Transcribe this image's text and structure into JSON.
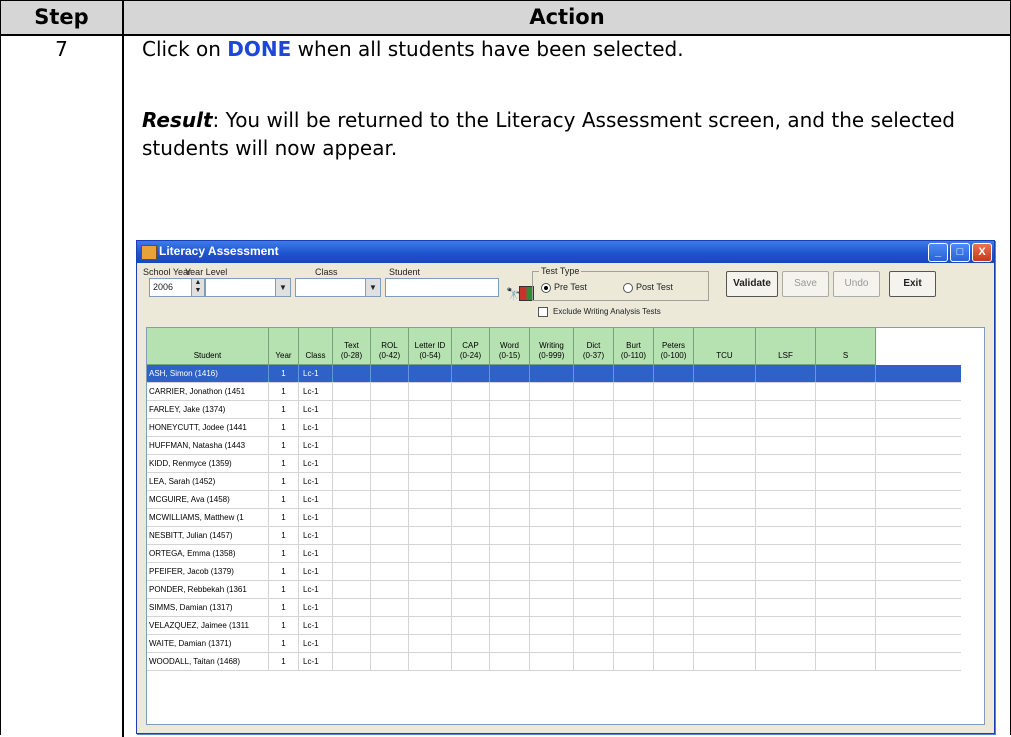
{
  "header": {
    "step": "Step",
    "action": "Action"
  },
  "step_number": "7",
  "instruction": {
    "prefix": "Click on ",
    "keyword": "DONE",
    "suffix": " when all students have been selected."
  },
  "result": {
    "label": "Result",
    "text": ": You will be returned to the Literacy Assessment screen, and the selected students will now appear."
  },
  "window": {
    "title": "Literacy Assessment",
    "controls": {
      "minimize": "_",
      "maximize": "□",
      "close": "X"
    },
    "toolbar": {
      "school_year_label": "School Year",
      "school_year_value": "2006",
      "year_level_label": "Year Level",
      "class_label": "Class",
      "student_label": "Student",
      "test_type_label": "Test Type",
      "pre_test": "Pre Test",
      "post_test": "Post Test",
      "exclude_label": "Exclude Writing Analysis Tests",
      "validate": "Validate",
      "save": "Save",
      "undo": "Undo",
      "exit": "Exit"
    },
    "grid": {
      "columns": [
        {
          "l1": "",
          "l2": "Student"
        },
        {
          "l1": "",
          "l2": "Year"
        },
        {
          "l1": "",
          "l2": "Class"
        },
        {
          "l1": "Text",
          "l2": "(0-28)"
        },
        {
          "l1": "ROL",
          "l2": "(0-42)"
        },
        {
          "l1": "Letter ID",
          "l2": "(0-54)"
        },
        {
          "l1": "CAP",
          "l2": "(0-24)"
        },
        {
          "l1": "Word",
          "l2": "(0-15)"
        },
        {
          "l1": "Writing",
          "l2": "(0-999)"
        },
        {
          "l1": "Dict",
          "l2": "(0-37)"
        },
        {
          "l1": "Burt",
          "l2": "(0-110)"
        },
        {
          "l1": "Peters",
          "l2": "(0-100)"
        },
        {
          "l1": "",
          "l2": "TCU"
        },
        {
          "l1": "",
          "l2": "LSF"
        },
        {
          "l1": "",
          "l2": "S"
        }
      ],
      "rows": [
        {
          "student": "ASH, Simon (1416)",
          "year": "1",
          "class": "Lc-1"
        },
        {
          "student": "CARRIER, Jonathon (1451",
          "year": "1",
          "class": "Lc-1"
        },
        {
          "student": "FARLEY, Jake (1374)",
          "year": "1",
          "class": "Lc-1"
        },
        {
          "student": "HONEYCUTT, Jodee (1441",
          "year": "1",
          "class": "Lc-1"
        },
        {
          "student": "HUFFMAN, Natasha (1443",
          "year": "1",
          "class": "Lc-1"
        },
        {
          "student": "KIDD, Renmyce (1359)",
          "year": "1",
          "class": "Lc-1"
        },
        {
          "student": "LEA, Sarah (1452)",
          "year": "1",
          "class": "Lc-1"
        },
        {
          "student": "MCGUIRE, Ava (1458)",
          "year": "1",
          "class": "Lc-1"
        },
        {
          "student": "MCWILLIAMS, Matthew (1",
          "year": "1",
          "class": "Lc-1"
        },
        {
          "student": "NESBITT, Julian (1457)",
          "year": "1",
          "class": "Lc-1"
        },
        {
          "student": "ORTEGA, Emma (1358)",
          "year": "1",
          "class": "Lc-1"
        },
        {
          "student": "PFEIFER, Jacob (1379)",
          "year": "1",
          "class": "Lc-1"
        },
        {
          "student": "PONDER, Rebbekah (1361",
          "year": "1",
          "class": "Lc-1"
        },
        {
          "student": "SIMMS, Damian (1317)",
          "year": "1",
          "class": "Lc-1"
        },
        {
          "student": "VELAZQUEZ, Jaimee (1311",
          "year": "1",
          "class": "Lc-1"
        },
        {
          "student": "WAITE, Damian (1371)",
          "year": "1",
          "class": "Lc-1"
        },
        {
          "student": "WOODALL, Taitan (1468)",
          "year": "1",
          "class": "Lc-1"
        }
      ]
    }
  }
}
